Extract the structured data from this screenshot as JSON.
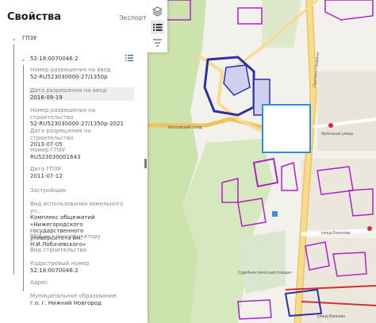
{
  "panel": {
    "title": "Свойства",
    "export_label": "Экспорт"
  },
  "layer": {
    "name": "ГПЗУ",
    "object_id": "52:18:0070046:2"
  },
  "attributes": [
    {
      "label": "Номер разрешения на ввод",
      "value": "52-RU523030000-27/1350р"
    },
    {
      "label": "Дата разрешения на ввод",
      "value": "2016-09-19"
    },
    {
      "label": "Номер разрешения на строительство",
      "value": "52-RU523030000-27/1350р-2021"
    },
    {
      "label": "Дата разрешения на строительство",
      "value": "2013-07-05"
    },
    {
      "label": "Номер ГПЗУ",
      "value": "RU523030001643"
    },
    {
      "label": "Дата ГПЗУ",
      "value": "2011-07-12"
    },
    {
      "label": "Застройщик",
      "value": ""
    },
    {
      "label": "Вид использования земельного уч...",
      "value": "Комплекс общежитий\n«Нижегородского государственного\nуниверситета им. Н.И.Лобачевского»"
    },
    {
      "label": "ВРИ по классификатору",
      "value": ""
    },
    {
      "label": "Вид строительства",
      "value": ""
    },
    {
      "label": "Кадастровый номер",
      "value": "52:18:0070046:2"
    },
    {
      "label": "Адрес",
      "value": ""
    },
    {
      "label": "Муниципальное образование",
      "value": "г.о. г. Нижний Новгород"
    }
  ],
  "map_labels": {
    "street_1": "Проспект Гагарина",
    "street_2": "Мопсовский съезд",
    "street_3": "Артельная улица",
    "street_4": "улица Бекетова",
    "street_5": "улица Ванеева",
    "station_label": "Судебное\nполосный\nстанция"
  },
  "icons": {
    "layers": "layers-icon",
    "attributes": "attributes-list-icon",
    "filter": "filter-icon"
  },
  "colors": {
    "parcel_outline": "#2e2ea8",
    "parcel_magenta": "#b020c8",
    "selected_parcel": "#2b8ee8",
    "road_orange": "#f0c35a",
    "road_red": "#d03030",
    "park_green": "#cfe3b0"
  }
}
